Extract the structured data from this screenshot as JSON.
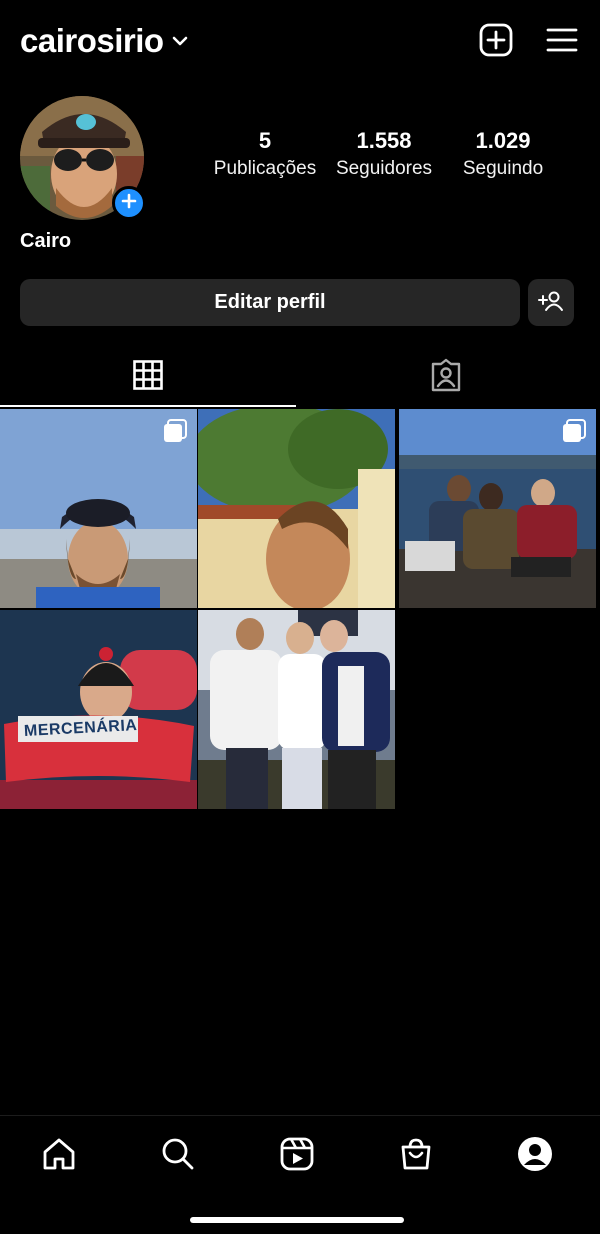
{
  "header": {
    "username": "cairosirio",
    "icons": {
      "account_switcher": "chevron-down-icon",
      "new_post": "plus-square-icon",
      "menu": "hamburger-menu-icon"
    }
  },
  "profile": {
    "display_name": "Cairo",
    "stats": [
      {
        "value": "5",
        "label": "Publicações"
      },
      {
        "value": "1.558",
        "label": "Seguidores"
      },
      {
        "value": "1.029",
        "label": "Seguindo"
      }
    ],
    "add_story_icon": "plus-icon"
  },
  "actions": {
    "edit_profile_label": "Editar perfil",
    "suggest_icon": "add-person-icon"
  },
  "tabs": [
    {
      "icon": "grid-icon",
      "active": true
    },
    {
      "icon": "tagged-person-icon",
      "active": false
    }
  ],
  "posts": [
    {
      "desc": "man in cap at beach",
      "multi": true
    },
    {
      "desc": "man profile under tree",
      "multi": false
    },
    {
      "desc": "friends on boat at lake",
      "multi": true
    },
    {
      "desc": "man holding mercenaria scarf",
      "multi": false
    },
    {
      "desc": "three friends posing at night",
      "multi": false
    }
  ],
  "post_scarf_text": "MERCENÁRIA",
  "bottom_nav": [
    {
      "icon": "home-icon"
    },
    {
      "icon": "search-icon"
    },
    {
      "icon": "reels-icon"
    },
    {
      "icon": "shop-bag-icon"
    },
    {
      "icon": "profile-avatar-icon"
    }
  ],
  "colors": {
    "background": "#000000",
    "button": "#262626",
    "accent": "#1e90ff",
    "text": "#ffffff"
  }
}
